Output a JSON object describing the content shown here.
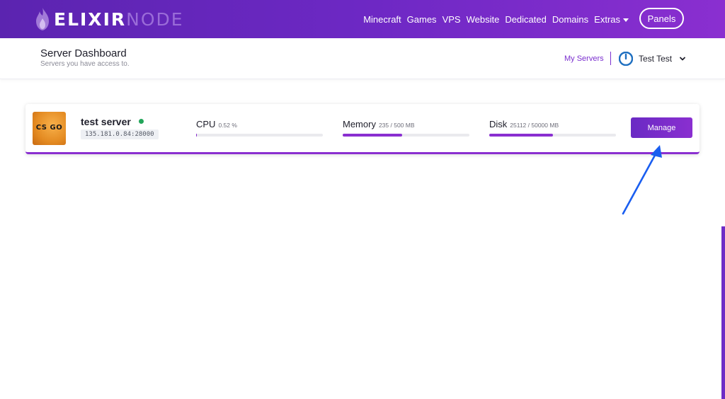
{
  "brand": {
    "name_bold": "ELIXIR",
    "name_light": "NODE"
  },
  "nav": {
    "links": [
      "Minecraft",
      "Games",
      "VPS",
      "Website",
      "Dedicated",
      "Domains",
      "Extras"
    ],
    "panels_label": "Panels"
  },
  "header": {
    "title": "Server Dashboard",
    "subtitle": "Servers you have access to.",
    "my_servers": "My Servers",
    "user_name": "Test Test"
  },
  "server": {
    "icon_text": "CS GO",
    "name": "test server",
    "status": "online",
    "address": "135.181.0.84:28000",
    "cpu": {
      "label": "CPU",
      "value": "0.52 %",
      "fraction": 0.0052
    },
    "memory": {
      "label": "Memory",
      "value": "235 / 500 MB",
      "fraction": 0.47
    },
    "disk": {
      "label": "Disk",
      "value": "25112 / 50000 MB",
      "fraction": 0.5022
    },
    "manage_label": "Manage"
  },
  "colors": {
    "accent": "#7b2fcf",
    "nav_gradient_start": "#5b24b0",
    "nav_gradient_end": "#8a2fd0",
    "status_online": "#22a55a",
    "annotation_arrow": "#1a5ef0"
  }
}
